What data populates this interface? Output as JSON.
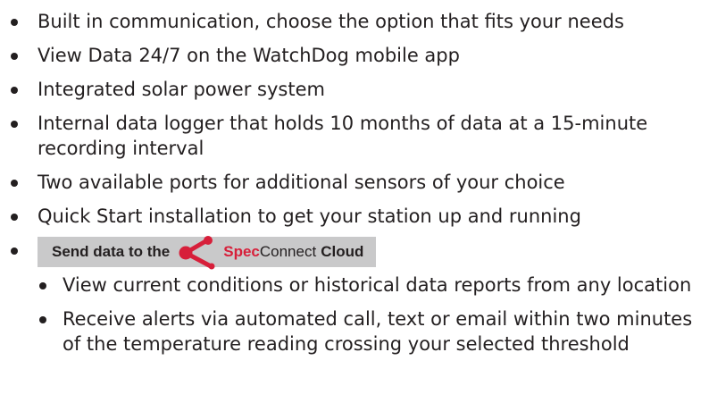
{
  "bullets": [
    "Built in communication, choose the option that fits your needs",
    "View Data 24/7 on the WatchDog mobile app",
    "Integrated solar power system",
    "Internal data logger that holds 10 months of data at a 15-minute recording interval",
    "Two available ports for additional sensors of your choice",
    "Quick Start installation to get your station up and running"
  ],
  "banner": {
    "prefix": "Send data to the",
    "brand_spec": "Spec",
    "brand_connect": "Connect",
    "brand_cloud": "Cloud",
    "icon": "specconnect-logo-icon",
    "background_color": "#c9c9ca",
    "accent_color": "#d71f3a"
  },
  "sub_bullets": [
    "View current conditions or historical data reports from any location",
    "Receive alerts via automated call, text or email within two minutes of the temperature reading crossing your selected threshold"
  ]
}
